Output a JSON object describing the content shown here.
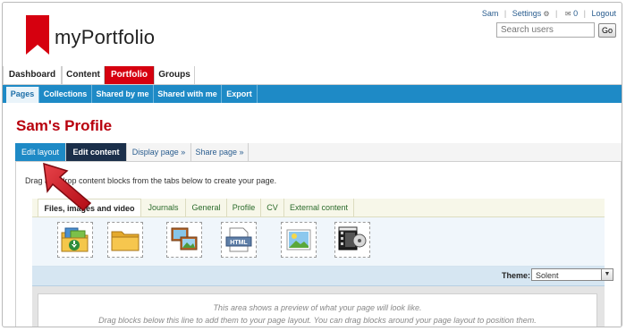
{
  "header": {
    "app_name": "myPortfolio",
    "user": "Sam",
    "settings_label": "Settings",
    "messages_count": "0",
    "logout_label": "Logout",
    "search_placeholder": "Search users",
    "go_label": "Go"
  },
  "main_nav": [
    "Dashboard",
    "Content",
    "Portfolio",
    "Groups"
  ],
  "sub_nav": [
    "Pages",
    "Collections",
    "Shared by me",
    "Shared with me",
    "Export"
  ],
  "page_title": "Sam's Profile",
  "edit_tabs": [
    "Edit layout",
    "Edit content",
    "Display page »",
    "Share page »"
  ],
  "instructions": "Drag and drop content blocks from the tabs below to create your page.",
  "block_categories": [
    "Files, images and video",
    "Journals",
    "General",
    "Profile",
    "CV",
    "External content"
  ],
  "blocks": [
    {
      "icon": "file-download-icon"
    },
    {
      "icon": "folder-icon"
    },
    {
      "icon": "image-gallery-icon"
    },
    {
      "icon": "html-icon"
    },
    {
      "icon": "image-icon"
    },
    {
      "icon": "video-icon"
    }
  ],
  "theme": {
    "label": "Theme:",
    "value": "Solent"
  },
  "preview": {
    "line1": "This area shows a preview of what your page will look like.",
    "line2": "Drag blocks below this line to add them to your page layout. You can drag blocks around your page layout to position them."
  },
  "colors": {
    "brand_red": "#d6000f",
    "nav_blue": "#1e8ac6",
    "dark_tab": "#1b2f4a",
    "title_red": "#b8000d"
  }
}
